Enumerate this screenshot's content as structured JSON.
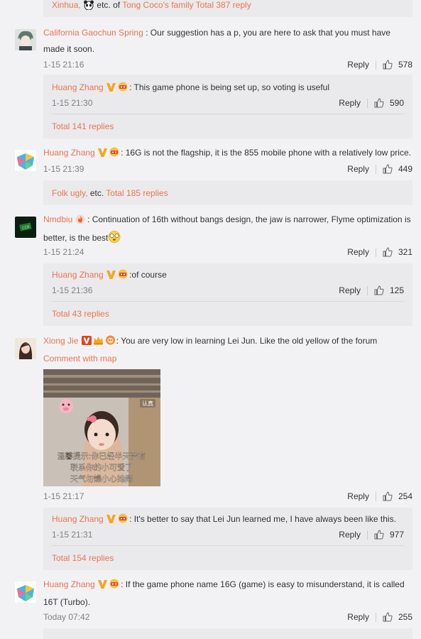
{
  "top_summary": {
    "name1": "Xinhua,",
    "mid": "etc. of",
    "name2": "Tong Coco's family",
    "total": "Total 387 reply"
  },
  "comments": [
    {
      "user": "California Gaochun Spring",
      "text_line1": " : Our suggestion has a p, you are here to ask that you must have",
      "text_line2": "made it soon.",
      "time": "1-15 21:16",
      "reply_label": "Reply",
      "likes": "578",
      "sub": {
        "user": "Huang Zhang",
        "text": ": This game phone is being set up, so voting is useful",
        "time": "1-15 21:30",
        "reply_label": "Reply",
        "likes": "590"
      },
      "total": "Total 141 replies"
    },
    {
      "user": "Huang Zhang",
      "text_line1": ": 16G is not the flagship, it is the 855 mobile phone with a relatively low price.",
      "time": "1-15 21:39",
      "reply_label": "Reply",
      "likes": "449",
      "summary": {
        "name": "Folk ugly,",
        "mid": "etc.",
        "total": "Total 185 replies"
      }
    },
    {
      "user": "Nmdbiu",
      "text_line1": " : Continuation of 16th without bangs design, the jaw is narrower, Flyme optimization is",
      "text_line2": "better, is the best",
      "time": "1-15 21:24",
      "reply_label": "Reply",
      "likes": "321",
      "sub": {
        "user": "Huang Zhang",
        "text": ":of course",
        "time": "1-15 21:36",
        "reply_label": "Reply",
        "likes": "125"
      },
      "total": "Total 43 replies"
    },
    {
      "user": "Xiong Jie",
      "text_line1": ": You are very low in learning Lei Jun. Like the old yellow of the forum",
      "comment_with_map": "Comment with map",
      "image_caption": [
        "温馨提示:你已经半天没有",
        "联系你的小可爱了",
        "天气勿燥小心她闹"
      ],
      "image_tag": "认真",
      "time": "1-15 21:17",
      "reply_label": "Reply",
      "likes": "254",
      "sub": {
        "user": "Huang Zhang",
        "text": ": It's better to say that Lei Jun learned me, I have always been like this.",
        "time": "1-15 21:31",
        "reply_label": "Reply",
        "likes": "977"
      },
      "total": "Total 154 replies"
    },
    {
      "user": "Huang Zhang",
      "text_line1": ": If the game phone name 16G (game) is easy to misunderstand, it is called",
      "text_line2": "16T (Turbo).",
      "time": "Today 07:42",
      "reply_label": "Reply",
      "likes": "255"
    }
  ],
  "colors": {
    "link": "#eb7350",
    "background": "#f2f2f5",
    "subbox": "#eaeaec",
    "time": "#808080"
  }
}
